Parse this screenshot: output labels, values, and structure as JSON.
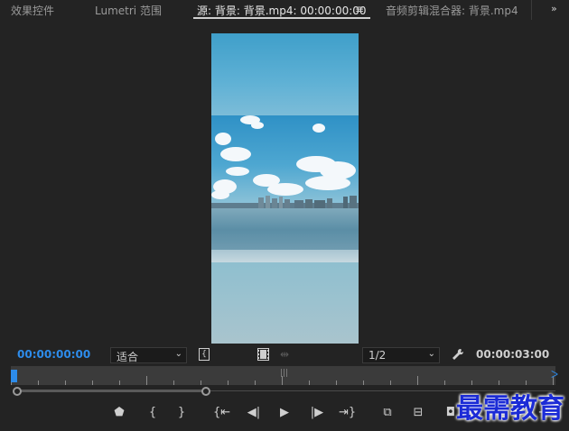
{
  "tabs": [
    {
      "label": "效果控件"
    },
    {
      "label": "Lumetri 范围"
    },
    {
      "label": "源: 背景: 背景.mp4: 00:00:00:00"
    },
    {
      "label": "音频剪辑混合器: 背景.mp4"
    }
  ],
  "tab_menu_icon": "hamburger-icon",
  "overflow_icon": "double-chevron-right-icon",
  "monitor": {
    "current_timecode": "00:00:00:00",
    "duration_timecode": "00:00:03:00",
    "zoom_select": "适合",
    "resolution_select": "1/2"
  },
  "timeline": {
    "zoom_start_fraction": 0.0,
    "zoom_end_fraction": 0.35
  },
  "transport_icons": [
    "add-marker-icon",
    "mark-in-icon",
    "mark-out-icon",
    "go-to-in-icon",
    "step-back-icon",
    "play-icon",
    "step-forward-icon",
    "go-to-out-icon",
    "insert-icon",
    "overwrite-icon",
    "export-frame-icon",
    "add-button-icon"
  ],
  "watermark": "最需教育",
  "colors": {
    "accent": "#2d8ceb",
    "background": "#232323",
    "watermark": "#1b2bd6"
  }
}
